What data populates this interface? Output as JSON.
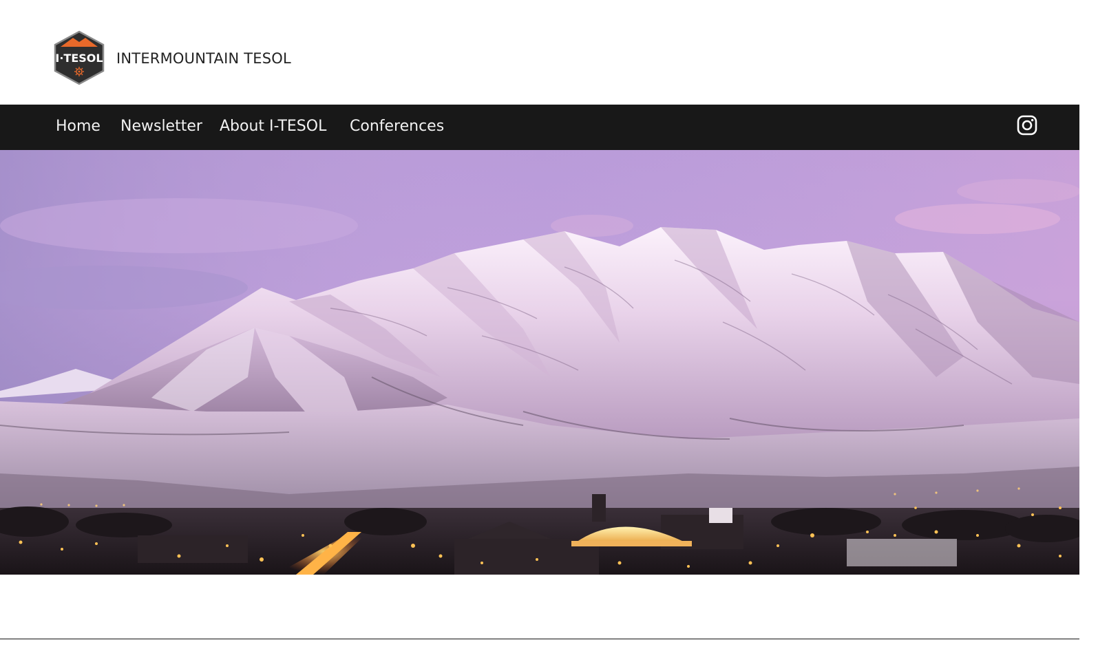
{
  "site": {
    "logo_text": "I·TESOL",
    "title": "INTERMOUNTAIN TESOL"
  },
  "nav": {
    "items": [
      {
        "label": "Home"
      },
      {
        "label": "Newsletter"
      },
      {
        "label": "About I-TESOL"
      },
      {
        "label": "Conferences"
      }
    ]
  },
  "social": {
    "icon": "instagram-icon"
  },
  "colors": {
    "navbar_bg": "#181818",
    "nav_text": "#f2f2f2",
    "logo_orange": "#e8692a",
    "logo_dark": "#2e2e2e"
  }
}
